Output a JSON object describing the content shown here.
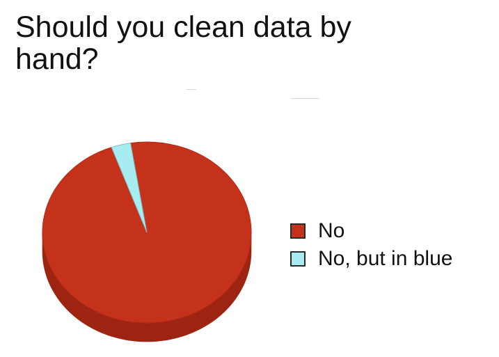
{
  "chart_data": {
    "type": "pie",
    "title": "Should you clean data by hand?",
    "slices": [
      {
        "label": "No",
        "value": 97,
        "color": "#c5321c",
        "side_color": "#9e2412"
      },
      {
        "label": "No, but in blue",
        "value": 3,
        "color": "#a8ecf2",
        "side_color": "#7ccbd3"
      }
    ],
    "start_angle_deg": -9,
    "legend_position": "right",
    "three_d": true
  }
}
